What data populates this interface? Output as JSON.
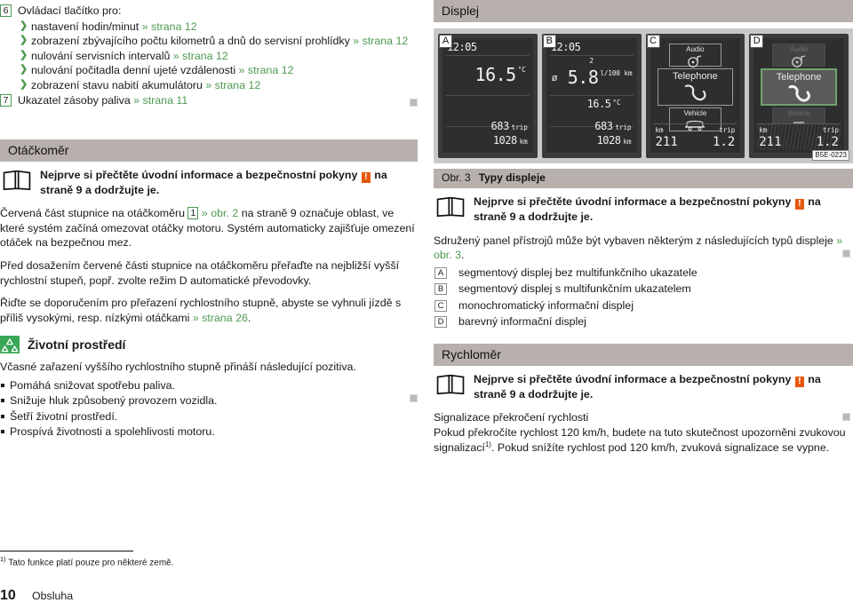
{
  "left_column": {
    "legend_items": [
      {
        "number": "6",
        "label": "Ovládací tlačítko pro:",
        "sub_items": [
          {
            "text": "nastavení hodin/minut",
            "ref": "» strana 12"
          },
          {
            "text": "zobrazení zbývajícího počtu kilometrů a dnů do servisní prohlídky",
            "ref": "» strana 12"
          },
          {
            "text": "nulování servisních intervalů",
            "ref": "» strana 12"
          },
          {
            "text": "nulování počitadla denní ujeté vzdálenosti",
            "ref": "» strana 12"
          },
          {
            "text": "zobrazení stavu nabití akumulátoru",
            "ref": "» strana 12"
          }
        ]
      },
      {
        "number": "7",
        "label": "Ukazatel zásoby paliva",
        "ref": "» strana 11",
        "sub_items": []
      }
    ],
    "section_tacho": {
      "title": "Otáčkoměr",
      "note_prefix": "Nejprve si přečtěte úvodní informace a bezpečnostní pokyny",
      "note_warn": "!",
      "note_suffix": "na straně 9 a dodržujte je.",
      "para1_a": "Červená část stupnice na otáčkoměru",
      "para1_ref_box": "1",
      "para1_ref": "» obr. 2",
      "para1_b": "na straně 9 označuje oblast, ve které systém začíná omezovat otáčky motoru. Systém automaticky zajišťuje omezení otáček na bezpečnou mez.",
      "para2": "Před dosažením červené části stupnice na otáčkoměru přeřaďte na nejbližší vyšší rychlostní stupeň, popř. zvolte režim D automatické převodovky.",
      "para3_a": "Řiďte se doporučením pro přeřazení rychlostního stupně, abyste se vyhnuli jízdě s příliš vysokými, resp. nízkými otáčkami",
      "para3_ref": "» strana 26",
      "para3_b": "."
    },
    "section_env": {
      "title": "Životní prostředí",
      "icon": "recycling-icon",
      "intro": "Včasné zařazení vyššího rychlostního stupně přináší následující pozitiva.",
      "bullets": [
        "Pomáhá snižovat spotřebu paliva.",
        "Snižuje hluk způsobený provozem vozidla.",
        "Šetří životní prostředí.",
        "Prospívá životnosti a spolehlivosti motoru."
      ]
    }
  },
  "right_column": {
    "section_display": {
      "title": "Displej"
    },
    "figure": {
      "code": "B5E-0223",
      "panels": [
        {
          "badge": "A",
          "type": "segment",
          "clock": "12:05",
          "temp_value": "16.5",
          "temp_unit": "°C",
          "trip_value": "683",
          "trip_label": "trip",
          "odo_value": "1028",
          "odo_label": "km"
        },
        {
          "badge": "B",
          "type": "segment-mfa",
          "clock": "12:05",
          "gear": "2",
          "avg_symbol": "ø",
          "consumption_value": "5.8",
          "consumption_unit": "l/100 km",
          "temp_value": "16.5",
          "temp_unit": "°C",
          "trip_value": "683",
          "trip_label": "trip",
          "odo_value": "1028",
          "odo_label": "km"
        },
        {
          "badge": "C",
          "type": "mono-info",
          "tiles": [
            {
              "label": "Audio",
              "icon": "audio-disc-icon",
              "state": "normal"
            },
            {
              "label": "Telephone",
              "icon": "phone-handset-icon",
              "state": "normal"
            },
            {
              "label": "Vehicle",
              "icon": "car-icon",
              "state": "normal"
            }
          ],
          "km_label": "km",
          "km_value": "211",
          "trip_label": "trip",
          "trip_value": "1.2"
        },
        {
          "badge": "D",
          "type": "color-info",
          "tiles": [
            {
              "label": "Audio",
              "icon": "audio-disc-icon",
              "state": "dim"
            },
            {
              "label": "Telephone",
              "icon": "phone-handset-icon",
              "state": "selected"
            },
            {
              "label": "Vehicle",
              "icon": "car-icon",
              "state": "dim"
            }
          ],
          "km_label": "km",
          "km_value": "211",
          "trip_label": "trip",
          "trip_value": "1.2"
        }
      ]
    },
    "caption": {
      "number": "Obr. 3",
      "text": "Typy displeje"
    },
    "note": {
      "prefix": "Nejprve si přečtěte úvodní informace a bezpečnostní pokyny",
      "warn": "!",
      "suffix": "na straně 9 a dodržujte je."
    },
    "intro_a": "Sdružený panel přístrojů může být vybaven některým z následujících typů displeje",
    "intro_ref": "» obr. 3",
    "intro_b": ".",
    "display_types": [
      {
        "label": "A",
        "text": "segmentový displej bez multifunkčního ukazatele"
      },
      {
        "label": "B",
        "text": "segmentový displej s multifunkčním ukazatelem"
      },
      {
        "label": "C",
        "text": "monochromatický informační displej"
      },
      {
        "label": "D",
        "text": "barevný informační displej"
      }
    ],
    "section_speedo": {
      "title": "Rychloměr",
      "note_prefix": "Nejprve si přečtěte úvodní informace a bezpečnostní pokyny",
      "note_warn": "!",
      "note_suffix": "na straně 9 a dodržujte je.",
      "sub_title": "Signalizace překročení rychlosti",
      "para_a": "Pokud překročíte rychlost 120 km/h, budete na tuto skutečnost upozorněni zvukovou signalizací",
      "para_footnote_mark": "1)",
      "para_b": ". Pokud snížíte rychlost pod 120 km/h, zvuková signalizace se vypne."
    }
  },
  "footnote": {
    "mark": "1)",
    "text": "Tato funkce platí pouze pro některé země."
  },
  "footer": {
    "page_number": "10",
    "section": "Obsluha"
  },
  "colors": {
    "accent_green": "#4e9a51",
    "bar_grey": "#b7b0ad",
    "warn_orange": "#e8570f",
    "env_green": "#3aa757"
  }
}
